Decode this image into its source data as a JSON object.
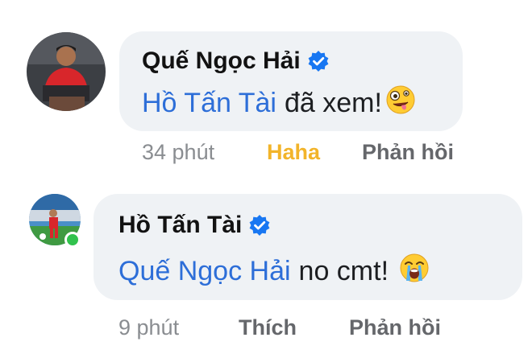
{
  "comments": [
    {
      "author": "Quế Ngọc Hải",
      "verified": true,
      "mention": "Hồ Tấn Tài",
      "text": "đã xem!",
      "emoji": "zany-face",
      "time": "34 phút",
      "reaction": "Haha",
      "reply": "Phản hồi"
    },
    {
      "author": "Hồ Tấn Tài",
      "verified": true,
      "online": true,
      "mention": "Quế Ngọc Hải",
      "text": "no cmt!",
      "emoji": "loudly-crying-face",
      "time": "9 phút",
      "like": "Thích",
      "reply": "Phản hồi"
    }
  ],
  "colors": {
    "bubble": "#eff2f5",
    "mention": "#2d6ed8",
    "haha": "#f2b42a",
    "verified": "#1877f2",
    "online": "#31c24d"
  }
}
